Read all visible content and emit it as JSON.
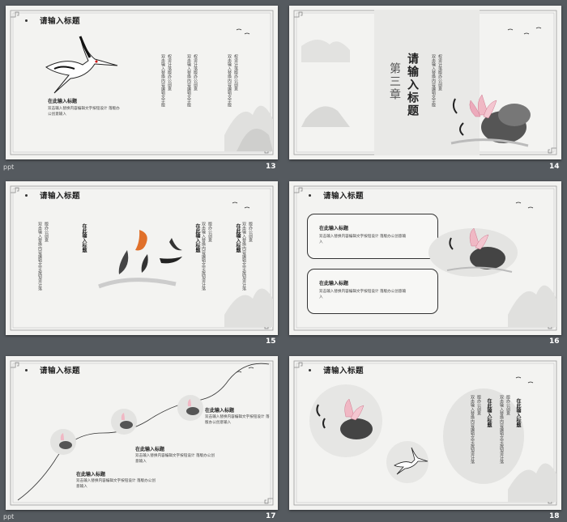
{
  "thumbnails": [
    {
      "number": "13",
      "app_label": "ppt"
    },
    {
      "number": "14",
      "app_label": ""
    },
    {
      "number": "15",
      "app_label": ""
    },
    {
      "number": "16",
      "app_label": ""
    },
    {
      "number": "17",
      "app_label": ""
    },
    {
      "number": "18",
      "app_label": ""
    }
  ],
  "s13": {
    "title": "请输入标题",
    "para_title": "在此输入标题",
    "para_body": "双击输入替换内容编辑文字按钮设计 落版办公创意输入",
    "vcols": [
      "双击输入替换内容编辑文字版",
      "权设计落版办公创意",
      "双击输入替换内容编辑文字版",
      "权设计落版办公创意"
    ]
  },
  "s14": {
    "chapter": "第三章",
    "title": "请输入标题",
    "vcols": [
      "双击输入替换内容编辑文字版",
      "权设计落版办公创意"
    ]
  },
  "s15": {
    "title": "请输入标题",
    "heads": [
      "在此输入标题",
      "在此输入标题"
    ],
    "vcols": [
      "双击输入替换内容编辑文字按钮设计落",
      "版办公创意"
    ]
  },
  "s16": {
    "title": "请输入标题",
    "cards": [
      {
        "title": "在此输入标题",
        "body": "双击输入替换内容编辑文字按钮设计 落版办公创意输入"
      },
      {
        "title": "在此输入标题",
        "body": "双击输入替换内容编辑文字按钮设计 落版办公创意输入"
      }
    ]
  },
  "s17": {
    "title": "请输入标题",
    "items": [
      {
        "title": "在此输入标题",
        "body": "双击输入替换内容编辑文字按钮设计 落版办公创意输入"
      },
      {
        "title": "在此输入标题",
        "body": "双击输入替换内容编辑文字按钮设计 落版办公创意输入"
      },
      {
        "title": "在此输入标题",
        "body": "双击输入替换内容编辑文字按钮设计 落版办公创意输入"
      }
    ]
  },
  "s18": {
    "title": "请输入标题",
    "heads": [
      "在此输入标题",
      "在此输入标题"
    ],
    "vcols": [
      "双击输入替换内容编辑文字按钮设计落",
      "版办公创意"
    ]
  },
  "colors": {
    "background": "#555a5f",
    "slide": "#f3f3f1",
    "ink": "#222222",
    "lotus": "#e8a0b0",
    "fish_orange": "#e0702a"
  }
}
